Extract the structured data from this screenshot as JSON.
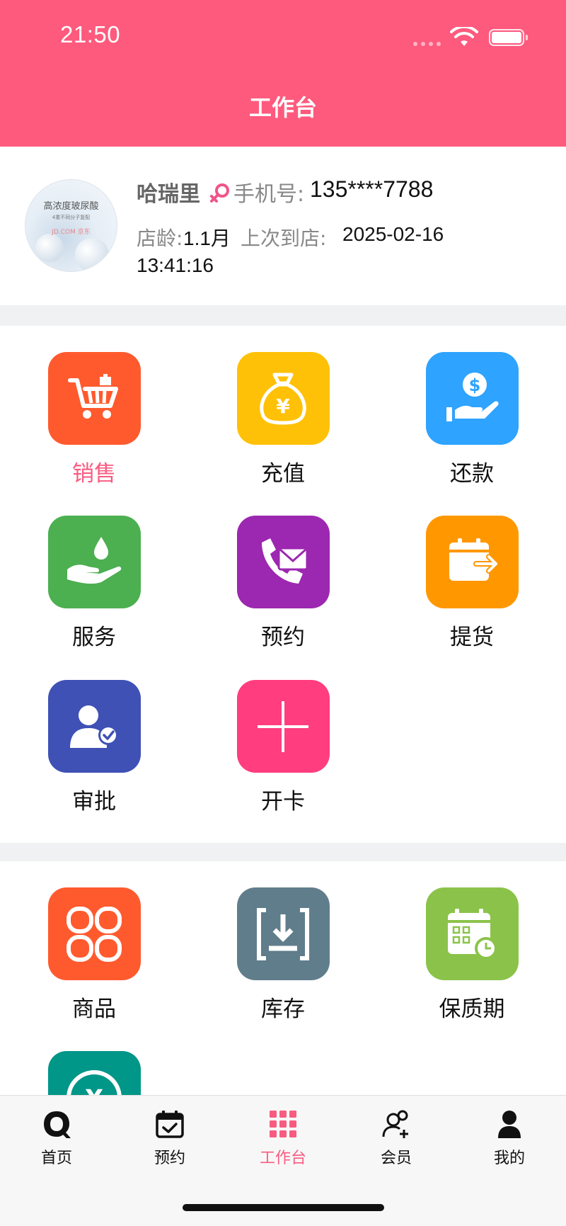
{
  "status_bar": {
    "time": "21:50"
  },
  "header": {
    "title": "工作台"
  },
  "member": {
    "name": "哈瑞里",
    "phone_label": "手机号:",
    "phone": "135****7788",
    "age_label": "店龄:",
    "age_value": "1.1月",
    "last_visit_label": "上次到店:",
    "last_visit_date": "2025-02-16",
    "last_visit_time": "13:41:16",
    "avatar": {
      "title": "高浓度玻尿酸",
      "subtitle": "4重不同分子复配",
      "brand": "JD.COM 京东"
    },
    "gender_color": "#f0548a"
  },
  "workbench": [
    {
      "label": "销售",
      "icon": "cart-icon",
      "color": "#ff5a2e",
      "active": true
    },
    {
      "label": "充值",
      "icon": "money-bag-icon",
      "color": "#ffc107"
    },
    {
      "label": "还款",
      "icon": "hand-coin-icon",
      "color": "#2ea3ff"
    },
    {
      "label": "服务",
      "icon": "hand-drop-icon",
      "color": "#4caf50"
    },
    {
      "label": "预约",
      "icon": "phone-mail-icon",
      "color": "#9c27b0"
    },
    {
      "label": "提货",
      "icon": "wallet-out-icon",
      "color": "#ff9800"
    },
    {
      "label": "审批",
      "icon": "user-check-icon",
      "color": "#3f51b5"
    },
    {
      "label": "开卡",
      "icon": "plus-icon",
      "color": "#ff3d7f"
    }
  ],
  "inventory": [
    {
      "label": "商品",
      "icon": "goods-icon",
      "color": "#ff5a2e"
    },
    {
      "label": "库存",
      "icon": "stock-icon",
      "color": "#607d8b"
    },
    {
      "label": "保质期",
      "icon": "calendar-clock-icon",
      "color": "#8bc34a"
    },
    {
      "label": "",
      "icon": "yuan-circle-icon",
      "color": "#009688"
    }
  ],
  "tabbar": [
    {
      "label": "首页",
      "icon": "home-q-icon"
    },
    {
      "label": "预约",
      "icon": "calendar-check-icon"
    },
    {
      "label": "工作台",
      "icon": "grid-icon",
      "active": true
    },
    {
      "label": "会员",
      "icon": "member-add-icon"
    },
    {
      "label": "我的",
      "icon": "person-icon"
    }
  ],
  "colors": {
    "accent": "#fe5a7d",
    "active_text": "#f85b80"
  }
}
